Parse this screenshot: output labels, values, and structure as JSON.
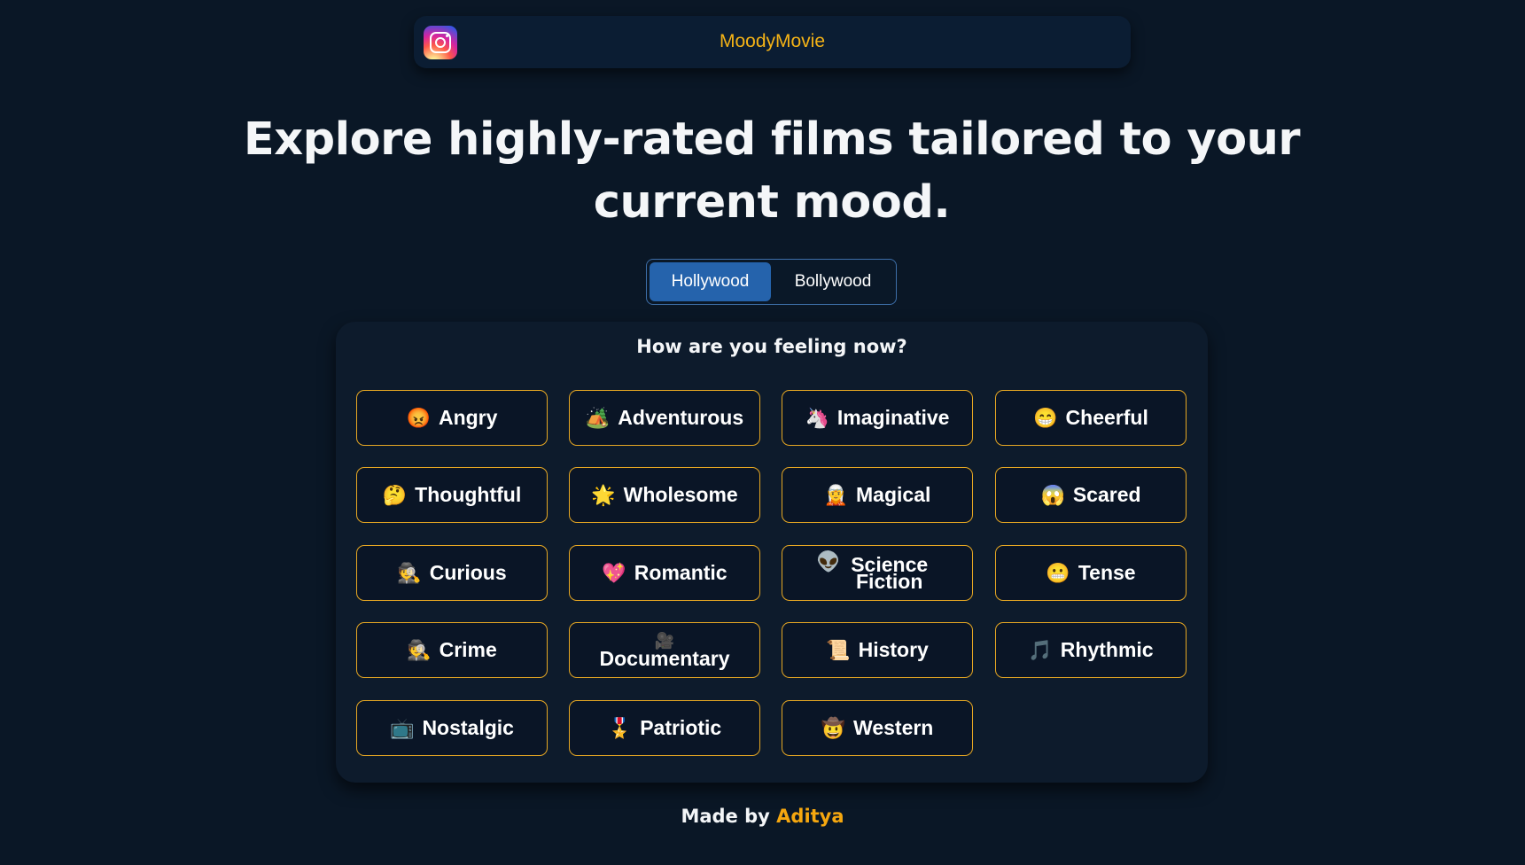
{
  "header": {
    "brand": "MoodyMovie",
    "logo_icon": "instagram-icon"
  },
  "headline": "Explore highly-rated films tailored to your current mood.",
  "industry_toggle": {
    "options": [
      "Hollywood",
      "Bollywood"
    ],
    "selected": "Hollywood"
  },
  "panel": {
    "title": "How are you feeling now?",
    "moods": [
      {
        "emoji": "😡",
        "label": "Angry",
        "icon": "angry-face-icon"
      },
      {
        "emoji": "🏕️",
        "label": "Adventurous",
        "icon": "camping-icon"
      },
      {
        "emoji": "🦄",
        "label": "Imaginative",
        "icon": "unicorn-icon"
      },
      {
        "emoji": "😁",
        "label": "Cheerful",
        "icon": "grinning-face-icon"
      },
      {
        "emoji": "🤔",
        "label": "Thoughtful",
        "icon": "thinking-face-icon"
      },
      {
        "emoji": "🌟",
        "label": "Wholesome",
        "icon": "star-icon"
      },
      {
        "emoji": "🧝",
        "label": "Magical",
        "icon": "elf-icon"
      },
      {
        "emoji": "😱",
        "label": "Scared",
        "icon": "screaming-face-icon"
      },
      {
        "emoji": "🕵️",
        "label": "Curious",
        "icon": "detective-icon"
      },
      {
        "emoji": "💖",
        "label": "Romantic",
        "icon": "heart-icon"
      },
      {
        "emoji": "👽",
        "label": "Science Fiction",
        "icon": "alien-icon"
      },
      {
        "emoji": "😬",
        "label": "Tense",
        "icon": "grimacing-face-icon"
      },
      {
        "emoji": "🕵️",
        "label": "Crime",
        "icon": "detective-icon"
      },
      {
        "emoji": "🎥",
        "label": "Documentary",
        "icon": "movie-camera-icon"
      },
      {
        "emoji": "📜",
        "label": "History",
        "icon": "scroll-icon"
      },
      {
        "emoji": "🎵",
        "label": "Rhythmic",
        "icon": "music-note-icon"
      },
      {
        "emoji": "📺",
        "label": "Nostalgic",
        "icon": "television-icon"
      },
      {
        "emoji": "🎖️",
        "label": "Patriotic",
        "icon": "medal-icon"
      },
      {
        "emoji": "🤠",
        "label": "Western",
        "icon": "cowboy-face-icon"
      }
    ]
  },
  "footer": {
    "prefix": "Made by",
    "author": "Aditya"
  },
  "colors": {
    "background": "#0a1726",
    "accent": "#f5b316",
    "toggle_active": "#2563ac",
    "button_border": "#e6a723"
  }
}
